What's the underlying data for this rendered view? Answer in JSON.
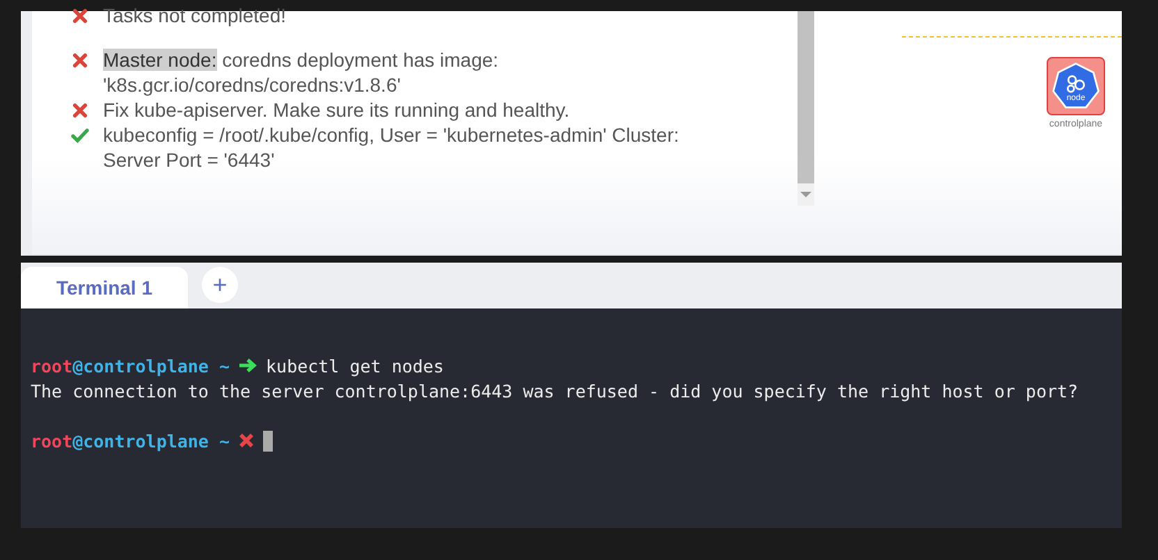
{
  "tasks": [
    {
      "passed": false,
      "lines": [
        "Tasks not completed!"
      ]
    },
    {
      "passed": false,
      "highlight": "Master node:",
      "lines": [
        "coredns deployment has image:",
        "'k8s.gcr.io/coredns/coredns:v1.8.6'"
      ]
    },
    {
      "passed": false,
      "lines": [
        "Fix kube-apiserver. Make sure its running and healthy."
      ]
    },
    {
      "passed": true,
      "lines": [
        "kubeconfig = /root/.kube/config, User = 'kubernetes-admin' Cluster:",
        "Server Port = '6443'"
      ]
    }
  ],
  "node": {
    "label": "node",
    "name": "controlplane",
    "alert": true
  },
  "tabs": [
    {
      "label": "Terminal 1",
      "selected": true
    }
  ],
  "add_tab": "+",
  "terminal": [
    {
      "kind": "blank"
    },
    {
      "kind": "prompt",
      "user": "root",
      "host": "@controlplane",
      "path": "~",
      "ok": true,
      "command": "kubectl get nodes"
    },
    {
      "kind": "output",
      "text": "The connection to the server controlplane:6443 was refused - did you specify the right host or port?"
    },
    {
      "kind": "blank"
    },
    {
      "kind": "prompt",
      "user": "root",
      "host": "@controlplane",
      "path": "~",
      "ok": false,
      "cursor": true
    }
  ]
}
